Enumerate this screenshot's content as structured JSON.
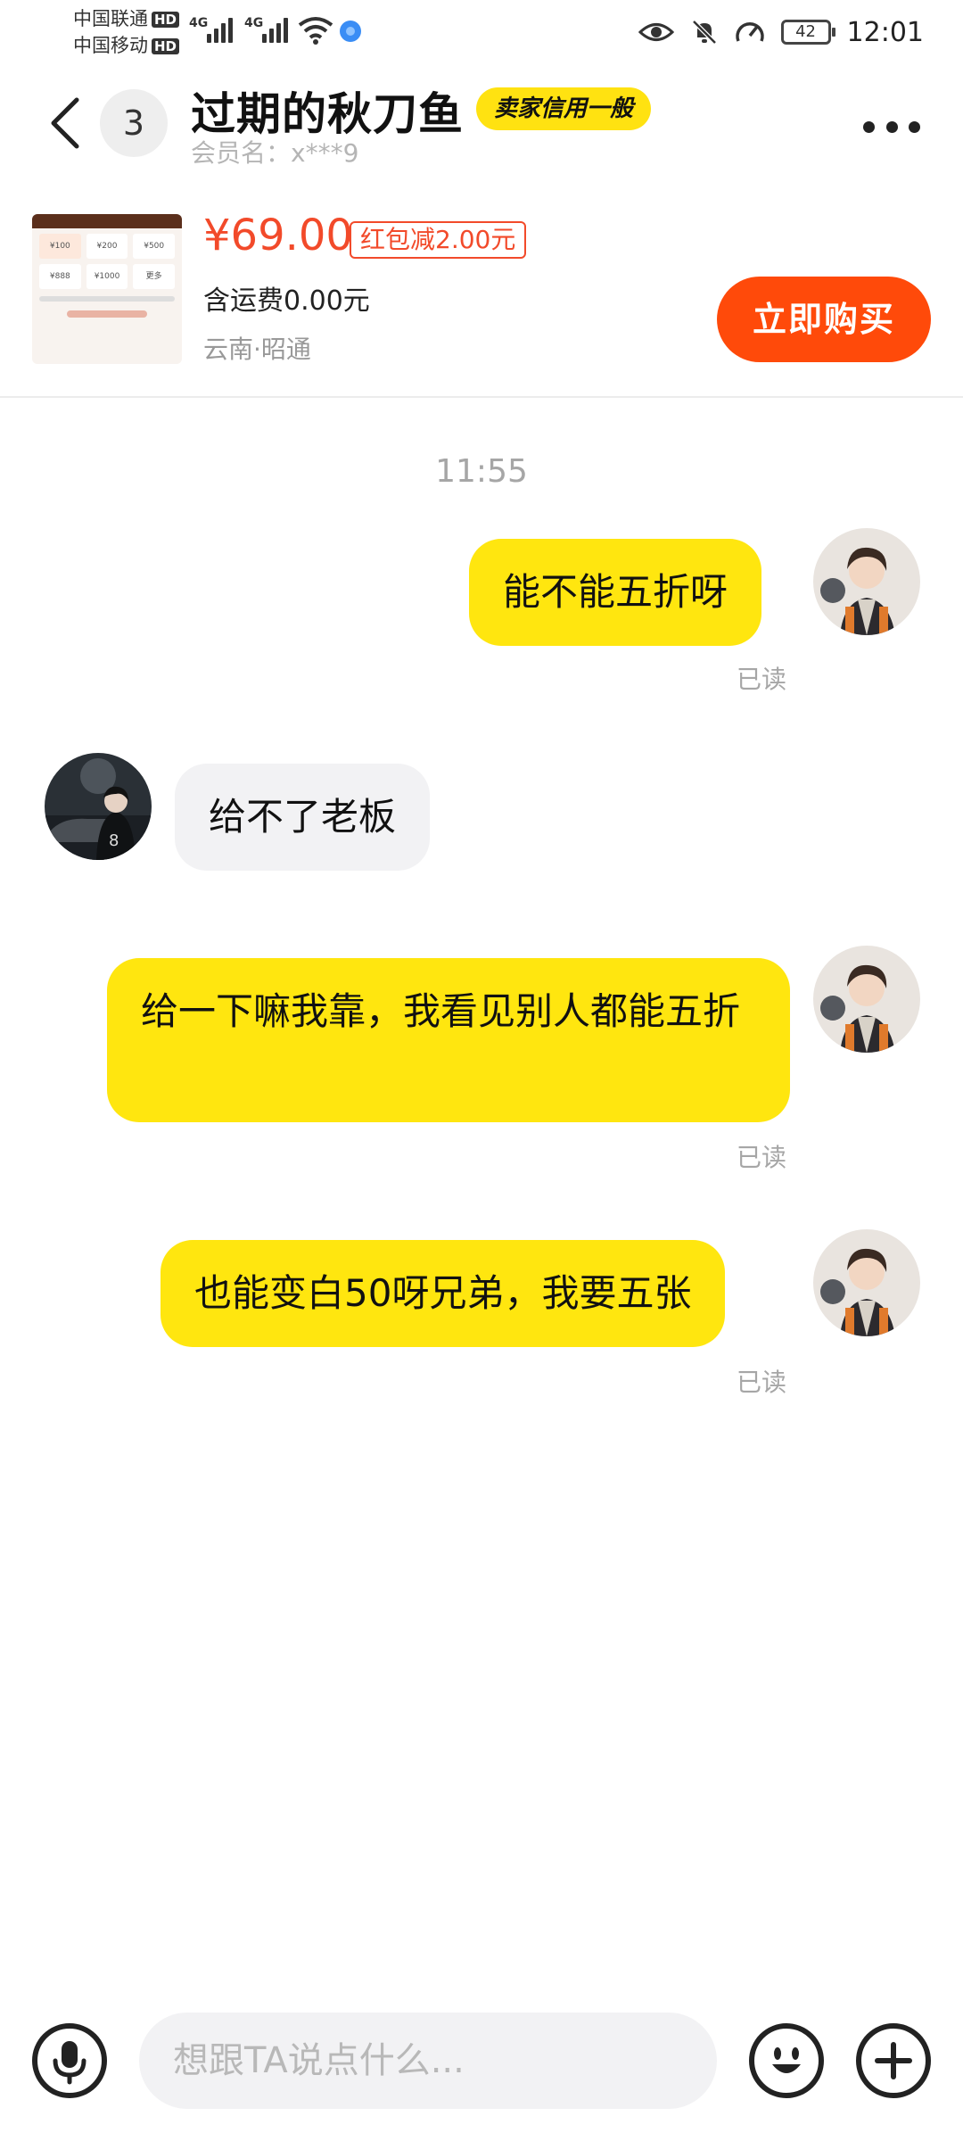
{
  "status_bar": {
    "carrier1": "中国联通",
    "carrier2": "中国移动",
    "hd_badge": "HD",
    "network1": "4G",
    "network2": "4G",
    "battery": "42",
    "time": "12:01"
  },
  "header": {
    "unread_count": "3",
    "title": "过期的秋刀鱼",
    "credit_badge": "卖家信用一般",
    "member_name": "会员名：x***9"
  },
  "product": {
    "price": "¥69.00",
    "coupon": "红包减2.00元",
    "shipping": "含运费0.00元",
    "location": "云南·昭通",
    "buy_label": "立即购买",
    "thumb_cells": [
      "¥100",
      "¥200",
      "¥500",
      "¥888",
      "¥1000",
      "更多"
    ]
  },
  "chat": {
    "timestamp": "11:55",
    "messages": [
      {
        "from": "me",
        "text": "能不能五折呀",
        "status": "已读"
      },
      {
        "from": "them",
        "text": "给不了老板"
      },
      {
        "from": "me",
        "text": "给一下嘛我靠，我看见别人都能五折",
        "status": "已读"
      },
      {
        "from": "me",
        "text": "也能变白50呀兄弟，我要五张",
        "status": "已读"
      }
    ]
  },
  "input_bar": {
    "placeholder": "想跟TA说点什么..."
  },
  "colors": {
    "accent_yellow": "#ffe60f",
    "buy_orange": "#ff4a0a",
    "price_red": "#f24a2a"
  },
  "icons": [
    "back-icon",
    "more-icon",
    "eye-icon",
    "mute-icon",
    "speed-icon",
    "wifi-icon",
    "mic-icon",
    "emoji-icon",
    "plus-icon"
  ]
}
